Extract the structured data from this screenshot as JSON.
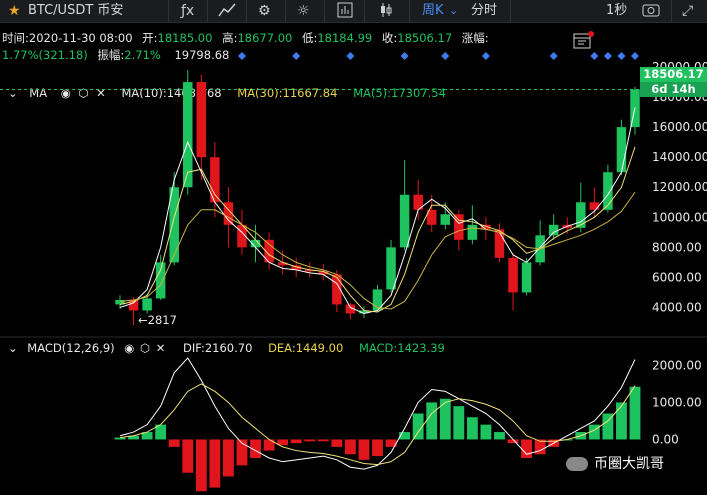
{
  "toolbar": {
    "pair": "BTC/USDT 币安",
    "period": "周K",
    "timeshare": "分时",
    "refresh": "1秒"
  },
  "info": {
    "time_label": "时间:",
    "time": "2020-11-30 08:00",
    "open_label": "开:",
    "open": "18185.00",
    "high_label": "高:",
    "high": "18677.00",
    "low_label": "低:",
    "low": "18184.99",
    "close_label": "收:",
    "close": "18506.17",
    "change_label": "涨幅:",
    "change": "1.77%(321.18)",
    "amp_label": "振幅:",
    "amp": "2.71%",
    "amp_val": "19798.68"
  },
  "ma": {
    "label": "MA",
    "ma10": "MA(10):14686.68",
    "ma30": "MA(30):11667.84",
    "ma5": "MA(5):17307.54"
  },
  "macd": {
    "label": "MACD(12,26,9)",
    "dif": "DIF:2160.70",
    "dea": "DEA:1449.00",
    "macd": "MACD:1423.39"
  },
  "price_tag": {
    "price": "18506.17",
    "countdown": "6d 14h"
  },
  "low_marker": "←2817",
  "watermark": "币圈大凯哥",
  "colors": {
    "up": "#1ec35f",
    "down": "#e0161c",
    "ma5": "#ffffff",
    "ma10": "#f2e27a",
    "ma30": "#c9b440",
    "marker": "#3d7df0"
  },
  "chart_data": [
    {
      "type": "candlestick",
      "title": "BTC/USDT 周K",
      "yticks": [
        4000,
        6000,
        8000,
        10000,
        12000,
        14000,
        16000,
        18000,
        20000
      ],
      "ylim": [
        2500,
        21000
      ],
      "series": [
        {
          "name": "MA(5)",
          "values": [
            4000,
            4300,
            5200,
            8000,
            12500,
            15000,
            13000,
            11000,
            9800,
            9000,
            8000,
            7000,
            6600,
            6500,
            6300,
            6200,
            5600,
            4000,
            3600,
            3800,
            4800,
            7500,
            10500,
            11200,
            10600,
            9600,
            9900,
            9200,
            9000,
            7500,
            7000,
            8000,
            9000,
            9400,
            9700,
            10400,
            11500,
            13000,
            17307
          ]
        },
        {
          "name": "MA(10)",
          "values": [
            4200,
            4400,
            4800,
            6500,
            10000,
            13000,
            13200,
            11500,
            10500,
            9500,
            8500,
            7500,
            7000,
            6700,
            6500,
            6400,
            6000,
            4800,
            3800,
            3700,
            4200,
            6200,
            9000,
            10800,
            10800,
            9800,
            9700,
            9400,
            9100,
            8500,
            7600,
            7900,
            8600,
            9100,
            9500,
            10000,
            10800,
            12000,
            14686
          ]
        },
        {
          "name": "MA(30)",
          "values": [
            4400,
            4500,
            4700,
            5500,
            7500,
            9500,
            10500,
            10500,
            10000,
            9500,
            9000,
            8200,
            7500,
            7000,
            6700,
            6500,
            6200,
            5500,
            4600,
            4000,
            3900,
            4400,
            5800,
            7500,
            8700,
            9100,
            9300,
            9200,
            9000,
            8600,
            8000,
            7900,
            8200,
            8500,
            8800,
            9200,
            9700,
            10400,
            11667
          ]
        }
      ],
      "candles": [
        {
          "o": 4200,
          "c": 4500,
          "h": 4800,
          "l": 3900
        },
        {
          "o": 4500,
          "c": 3800,
          "h": 4700,
          "l": 2817
        },
        {
          "o": 3800,
          "c": 4600,
          "h": 4900,
          "l": 3600
        },
        {
          "o": 4600,
          "c": 7000,
          "h": 7500,
          "l": 4500
        },
        {
          "o": 7000,
          "c": 12000,
          "h": 13000,
          "l": 6800
        },
        {
          "o": 12000,
          "c": 19000,
          "h": 19798,
          "l": 11500
        },
        {
          "o": 19000,
          "c": 14000,
          "h": 19500,
          "l": 12500
        },
        {
          "o": 14000,
          "c": 11000,
          "h": 15000,
          "l": 10000
        },
        {
          "o": 11000,
          "c": 9500,
          "h": 12000,
          "l": 8000
        },
        {
          "o": 9500,
          "c": 8000,
          "h": 10500,
          "l": 7500
        },
        {
          "o": 8000,
          "c": 8500,
          "h": 9500,
          "l": 7000
        },
        {
          "o": 8500,
          "c": 7000,
          "h": 9000,
          "l": 6500
        },
        {
          "o": 7000,
          "c": 6800,
          "h": 7800,
          "l": 6200
        },
        {
          "o": 6800,
          "c": 6500,
          "h": 7300,
          "l": 6000
        },
        {
          "o": 6500,
          "c": 6400,
          "h": 7000,
          "l": 6000
        },
        {
          "o": 6400,
          "c": 6200,
          "h": 6900,
          "l": 5800
        },
        {
          "o": 6200,
          "c": 4200,
          "h": 6500,
          "l": 3700
        },
        {
          "o": 4200,
          "c": 3600,
          "h": 4300,
          "l": 3200
        },
        {
          "o": 3600,
          "c": 3800,
          "h": 4100,
          "l": 3300
        },
        {
          "o": 3800,
          "c": 5200,
          "h": 5500,
          "l": 3700
        },
        {
          "o": 5200,
          "c": 8000,
          "h": 8500,
          "l": 5000
        },
        {
          "o": 8000,
          "c": 11500,
          "h": 13800,
          "l": 7800
        },
        {
          "o": 11500,
          "c": 10500,
          "h": 12500,
          "l": 9800
        },
        {
          "o": 10500,
          "c": 9500,
          "h": 11500,
          "l": 9000
        },
        {
          "o": 9500,
          "c": 10200,
          "h": 11000,
          "l": 9200
        },
        {
          "o": 10200,
          "c": 8500,
          "h": 10500,
          "l": 7800
        },
        {
          "o": 8500,
          "c": 9500,
          "h": 10800,
          "l": 8200
        },
        {
          "o": 9500,
          "c": 9200,
          "h": 10000,
          "l": 8500
        },
        {
          "o": 9200,
          "c": 7300,
          "h": 9600,
          "l": 7000
        },
        {
          "o": 7300,
          "c": 5000,
          "h": 7600,
          "l": 3800
        },
        {
          "o": 5000,
          "c": 7000,
          "h": 7300,
          "l": 4800
        },
        {
          "o": 7000,
          "c": 8800,
          "h": 9800,
          "l": 6800
        },
        {
          "o": 8800,
          "c": 9500,
          "h": 10200,
          "l": 8500
        },
        {
          "o": 9500,
          "c": 9300,
          "h": 10000,
          "l": 8900
        },
        {
          "o": 9300,
          "c": 11000,
          "h": 12300,
          "l": 9000
        },
        {
          "o": 11000,
          "c": 10500,
          "h": 12000,
          "l": 10000
        },
        {
          "o": 10500,
          "c": 13000,
          "h": 13500,
          "l": 10300
        },
        {
          "o": 13000,
          "c": 16000,
          "h": 16500,
          "l": 12800
        },
        {
          "o": 16000,
          "c": 18506,
          "h": 18677,
          "l": 15500
        }
      ]
    },
    {
      "type": "bar",
      "title": "MACD(12,26,9)",
      "yticks": [
        0,
        1000,
        2000
      ],
      "ylim": [
        -1500,
        2200
      ],
      "series": [
        {
          "name": "MACD",
          "values": [
            50,
            100,
            200,
            400,
            -200,
            -900,
            -1400,
            -1300,
            -1000,
            -700,
            -500,
            -300,
            -150,
            -100,
            -50,
            -50,
            -200,
            -400,
            -550,
            -450,
            -200,
            200,
            700,
            1000,
            1100,
            900,
            600,
            400,
            200,
            -100,
            -500,
            -400,
            -200,
            0,
            200,
            400,
            700,
            1000,
            1423
          ]
        },
        {
          "name": "DIF",
          "values": [
            100,
            200,
            400,
            900,
            1800,
            2200,
            1600,
            900,
            300,
            -100,
            -300,
            -500,
            -600,
            -550,
            -500,
            -450,
            -550,
            -750,
            -800,
            -700,
            -350,
            300,
            1000,
            1350,
            1300,
            1100,
            900,
            700,
            400,
            0,
            -400,
            -300,
            -100,
            100,
            300,
            500,
            900,
            1400,
            2160
          ]
        },
        {
          "name": "DEA",
          "values": [
            50,
            100,
            200,
            400,
            800,
            1300,
            1500,
            1300,
            1000,
            600,
            300,
            0,
            -200,
            -300,
            -350,
            -380,
            -450,
            -550,
            -650,
            -680,
            -600,
            -350,
            200,
            700,
            1000,
            1100,
            1050,
            950,
            800,
            500,
            100,
            -50,
            -50,
            0,
            100,
            250,
            500,
            900,
            1449
          ]
        }
      ]
    }
  ]
}
